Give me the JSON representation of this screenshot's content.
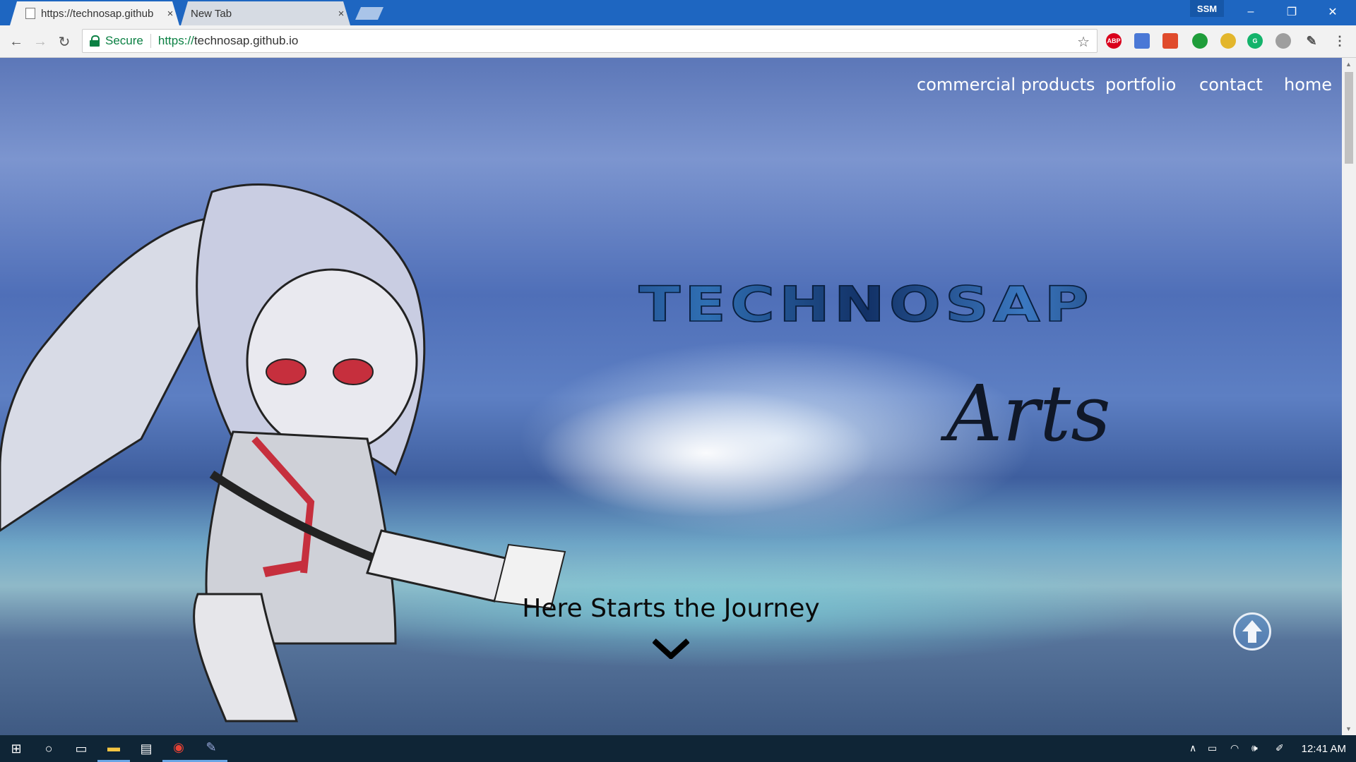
{
  "browser": {
    "tabs": [
      {
        "title": "https://technosap.github",
        "close": "×"
      },
      {
        "title": "New Tab",
        "close": "×"
      }
    ],
    "profile": "SSM",
    "window_controls": {
      "minimize": "–",
      "restore": "❐",
      "close": "✕"
    },
    "omnibox": {
      "secure_label": "Secure",
      "scheme": "https://",
      "host": "technosap.github.io"
    },
    "extensions": [
      {
        "name": "adblock-plus-icon",
        "label": "ABP",
        "color": "#d9001b"
      },
      {
        "name": "translate-icon",
        "label": "",
        "color": "#4a78d6"
      },
      {
        "name": "extension-icon",
        "label": "",
        "color": "#e04b2c"
      },
      {
        "name": "chat-extension-icon",
        "label": "",
        "color": "#1f9d3a"
      },
      {
        "name": "ring-extension-icon",
        "label": "",
        "color": "#e3b62c"
      },
      {
        "name": "grammarly-icon",
        "label": "G",
        "color": "#14b36b"
      },
      {
        "name": "drive-icon",
        "label": "",
        "color": "#9e9e9e"
      },
      {
        "name": "eyedropper-icon",
        "label": "",
        "color": "#555555"
      }
    ]
  },
  "site": {
    "nav": [
      "commercial products",
      "portfolio",
      "contact",
      "home"
    ],
    "logo_text": "TECHNOSAP",
    "logo_script": "Arts",
    "hero_heading": "Here Starts the Journey"
  },
  "taskbar": {
    "time": "12:41 AM"
  }
}
